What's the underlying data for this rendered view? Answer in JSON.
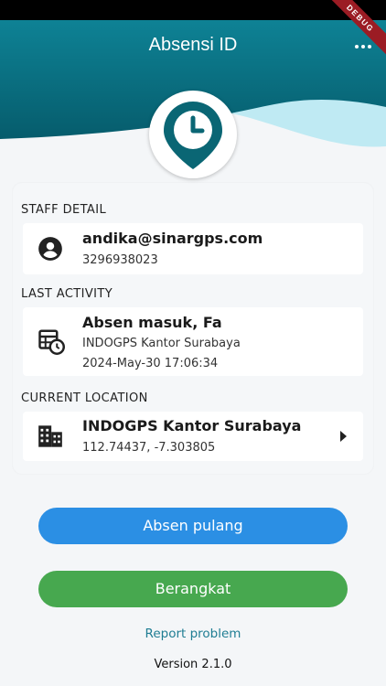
{
  "app": {
    "title": "Absensi ID",
    "debug_label": "DEBUG"
  },
  "colors": {
    "header_teal": "#0d6f80",
    "wave_light": "#bfeaf3",
    "primary_blue": "#2b8fe4",
    "success_green": "#47a84f",
    "link_teal": "#1f7d93"
  },
  "icons": {
    "menu": "more-horizontal-icon",
    "logo": "location-clock-pin-icon",
    "staff": "account-circle-icon",
    "activity": "calendar-clock-icon",
    "location": "office-building-icon",
    "chevron": "chevron-right-icon"
  },
  "staff": {
    "section_label": "STAFF DETAIL",
    "email": "andika@sinargps.com",
    "id": "3296938023"
  },
  "last_activity": {
    "section_label": "LAST ACTIVITY",
    "title": "Absen masuk, Fa",
    "place": "INDOGPS Kantor Surabaya",
    "datetime": "2024-May-30 17:06:34"
  },
  "current_location": {
    "section_label": "CURRENT LOCATION",
    "name": "INDOGPS Kantor Surabaya",
    "coords": "112.74437, -7.303805"
  },
  "actions": {
    "checkout_label": "Absen pulang",
    "depart_label": "Berangkat",
    "report_label": "Report problem"
  },
  "footer": {
    "version": "Version 2.1.0"
  }
}
